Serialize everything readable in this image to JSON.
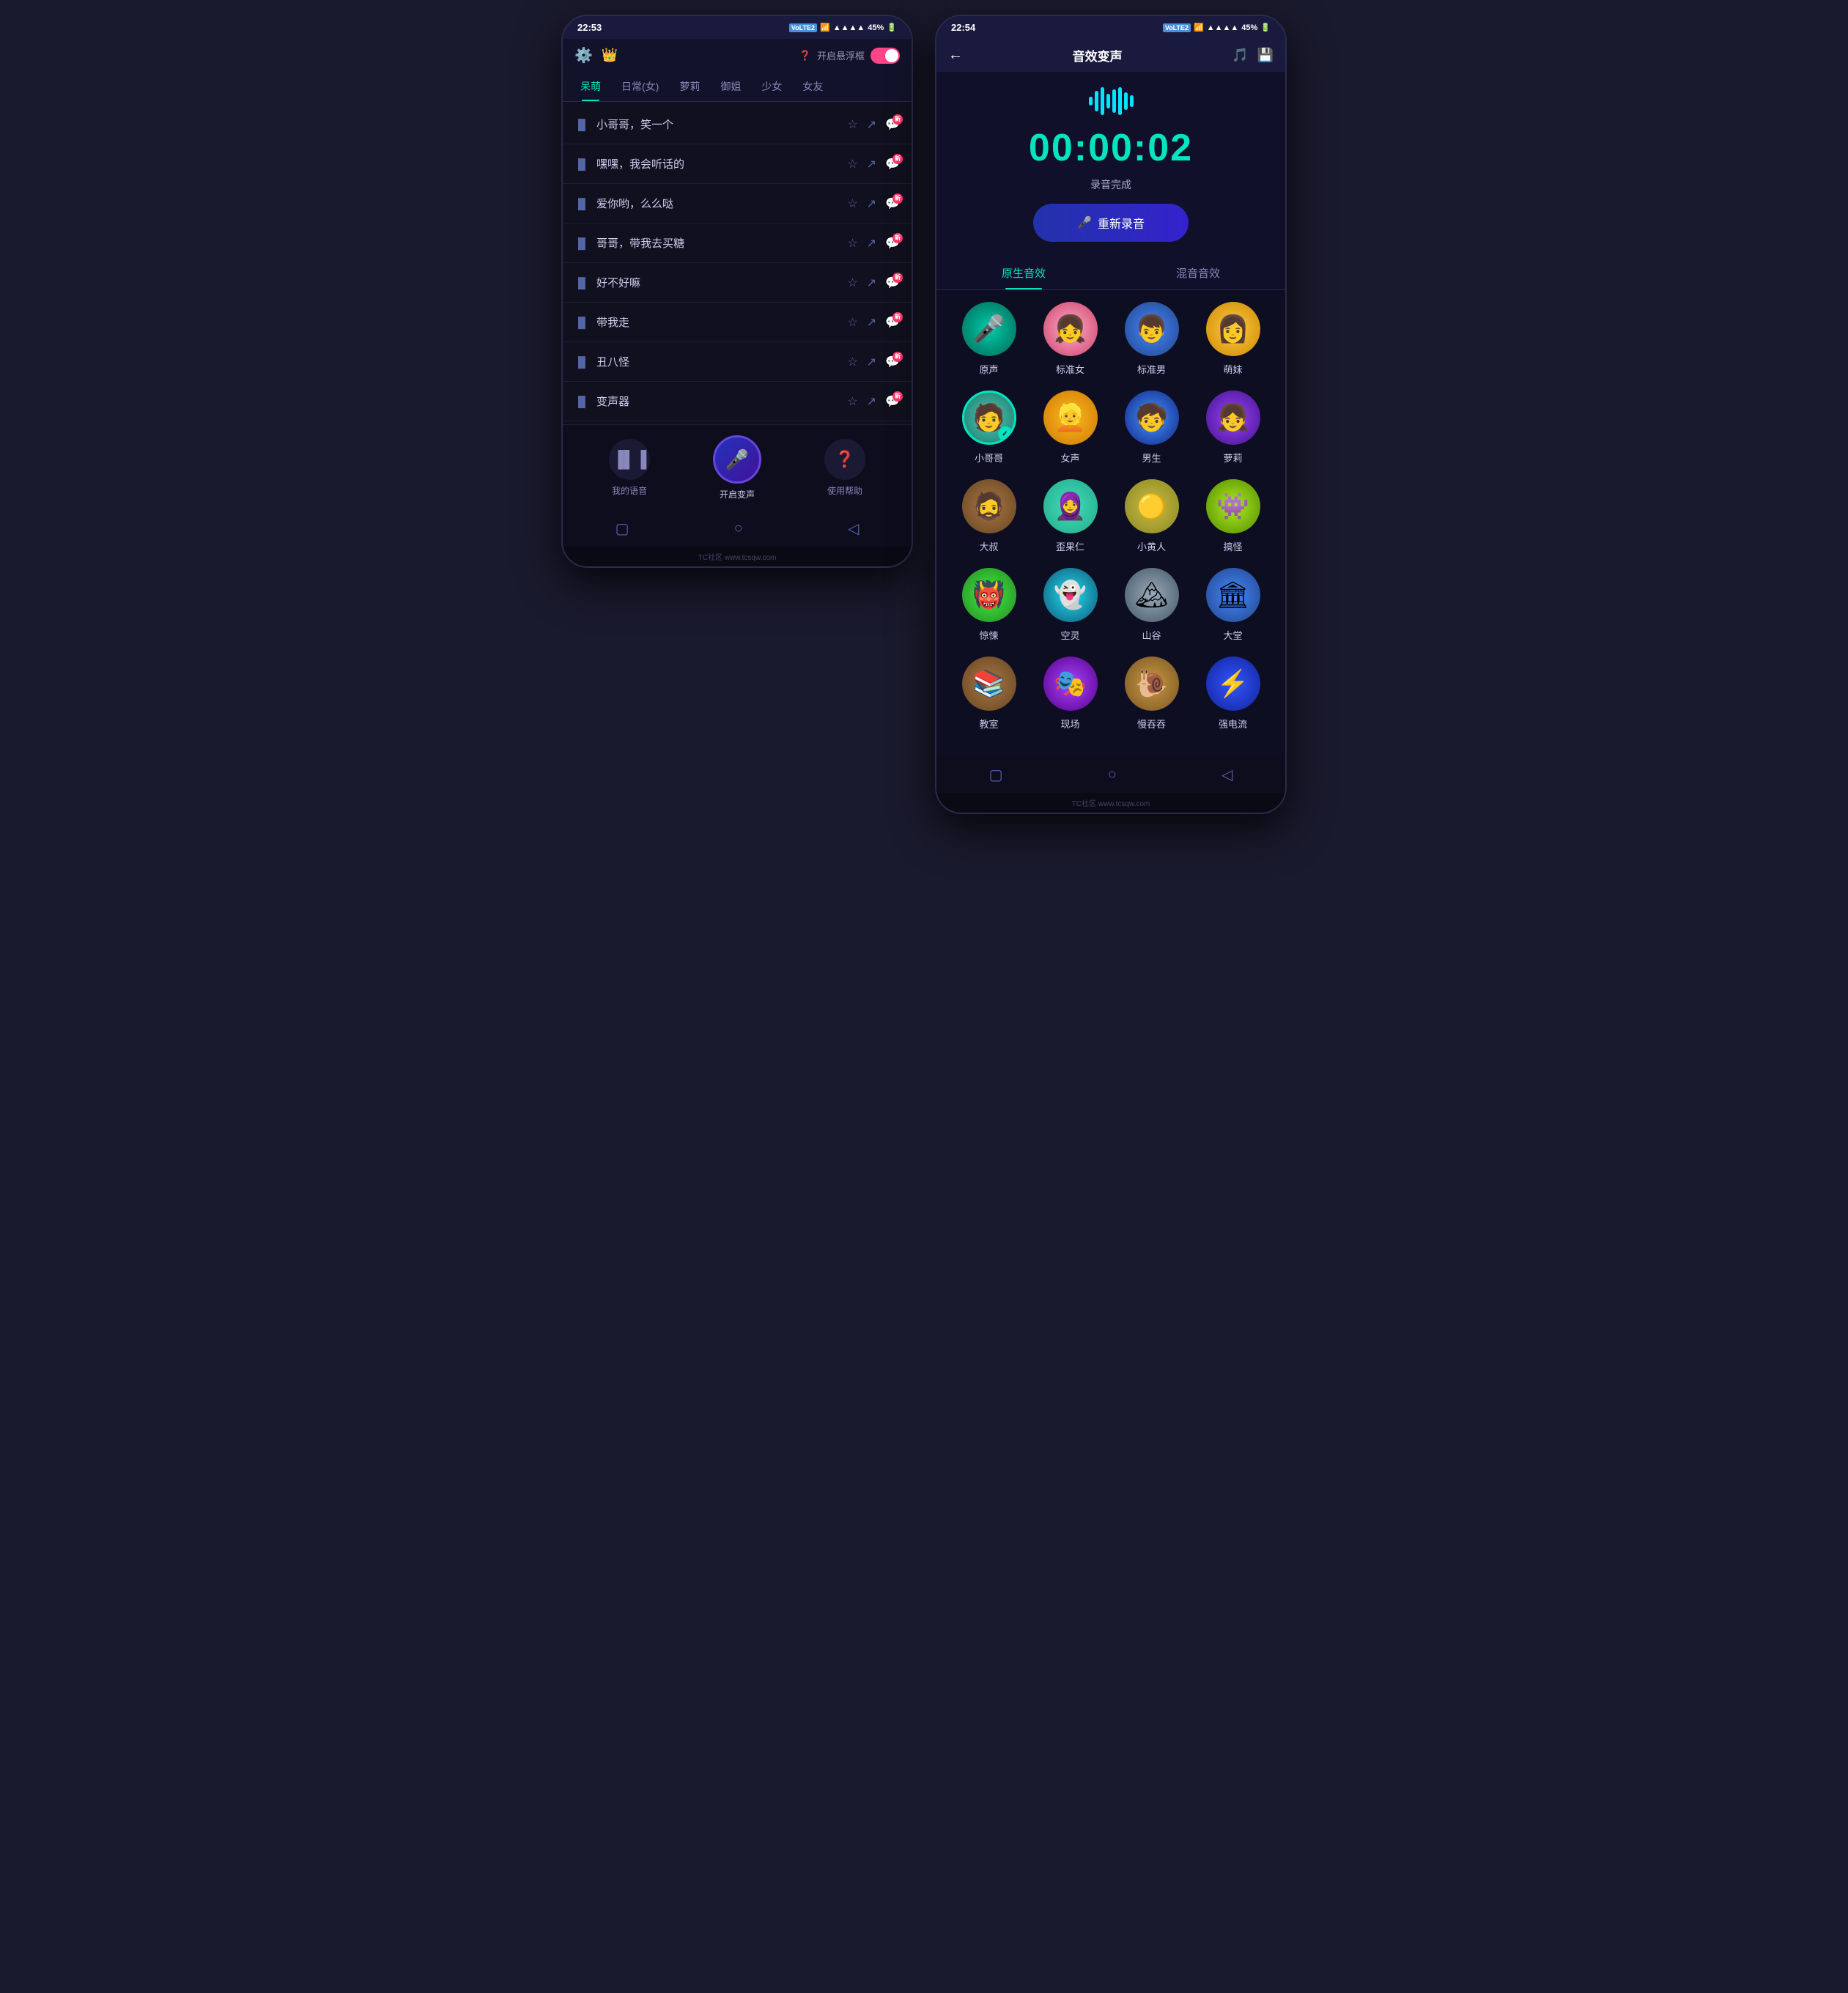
{
  "phone1": {
    "status": {
      "time": "22:53",
      "network": "VoLTE 2",
      "signal": "▲▲▲▲",
      "battery": "45%"
    },
    "header": {
      "floating_label": "开启悬浮框",
      "toggle_state": "on"
    },
    "tabs": [
      {
        "label": "呆萌",
        "active": true
      },
      {
        "label": "日常(女)",
        "active": false
      },
      {
        "label": "萝莉",
        "active": false
      },
      {
        "label": "御姐",
        "active": false
      },
      {
        "label": "少女",
        "active": false
      },
      {
        "label": "女友",
        "active": false
      }
    ],
    "list_items": [
      {
        "text": "小哥哥，笑一个"
      },
      {
        "text": "嘿嘿，我会听话的"
      },
      {
        "text": "爱你哟，么么哒"
      },
      {
        "text": "哥哥，带我去买糖"
      },
      {
        "text": "好不好嘛"
      },
      {
        "text": "带我走"
      },
      {
        "text": "丑八怪"
      },
      {
        "text": "变声器"
      }
    ],
    "bottom_buttons": [
      {
        "label": "我的语音",
        "icon": "waveform"
      },
      {
        "label": "开启变声",
        "icon": "mic",
        "center": true
      },
      {
        "label": "使用帮助",
        "icon": "question"
      }
    ],
    "new_badge": "新"
  },
  "phone2": {
    "status": {
      "time": "22:54",
      "network": "VoLTE 2",
      "signal": "▲▲▲▲",
      "battery": "45%"
    },
    "header": {
      "title": "音效变声",
      "back": "←"
    },
    "timer": "00:00:02",
    "record_status": "录音完成",
    "rerecord_label": "重新录音",
    "effects_tabs": [
      {
        "label": "原生音效",
        "active": true
      },
      {
        "label": "混音音效",
        "active": false
      }
    ],
    "effects": [
      [
        {
          "name": "原声",
          "emoji": "🎤",
          "bg": "av-teal",
          "selected": false
        },
        {
          "name": "标准女",
          "emoji": "👧",
          "bg": "av-pink",
          "selected": false
        },
        {
          "name": "标准男",
          "emoji": "👦",
          "bg": "av-blue",
          "selected": false
        },
        {
          "name": "萌妹",
          "emoji": "👩",
          "bg": "av-yellow",
          "selected": false
        }
      ],
      [
        {
          "name": "小哥哥",
          "emoji": "🧑",
          "bg": "av-teal2",
          "selected": true
        },
        {
          "name": "女声",
          "emoji": "👱",
          "bg": "av-amber",
          "selected": false
        },
        {
          "name": "男生",
          "emoji": "🧒",
          "bg": "av-blue2",
          "selected": false
        },
        {
          "name": "萝莉",
          "emoji": "👧",
          "bg": "av-purple",
          "selected": false
        }
      ],
      [
        {
          "name": "大叔",
          "emoji": "🧔",
          "bg": "av-brown",
          "selected": false
        },
        {
          "name": "歪果仁",
          "emoji": "🧕",
          "bg": "av-mint",
          "selected": false
        },
        {
          "name": "小黄人",
          "emoji": "🟡",
          "bg": "av-olive",
          "selected": false
        },
        {
          "name": "搞怪",
          "emoji": "👾",
          "bg": "av-lime",
          "selected": false
        }
      ],
      [
        {
          "name": "惊悚",
          "emoji": "👹",
          "bg": "av-green",
          "selected": false
        },
        {
          "name": "空灵",
          "emoji": "👻",
          "bg": "av-cyan",
          "selected": false
        },
        {
          "name": "山谷",
          "emoji": "🏔",
          "bg": "av-gray",
          "selected": false
        },
        {
          "name": "大堂",
          "emoji": "🏛",
          "bg": "av-blue",
          "selected": false
        }
      ],
      [
        {
          "name": "教室",
          "emoji": "📚",
          "bg": "av-brown",
          "selected": false
        },
        {
          "name": "现场",
          "emoji": "🎭",
          "bg": "av-purple2",
          "selected": false
        },
        {
          "name": "慢吞吞",
          "emoji": "🐌",
          "bg": "av-snail",
          "selected": false
        },
        {
          "name": "强电流",
          "emoji": "⚡",
          "bg": "av-electric",
          "selected": false
        }
      ]
    ]
  },
  "watermark": "TC社区 www.tcsqw.com"
}
